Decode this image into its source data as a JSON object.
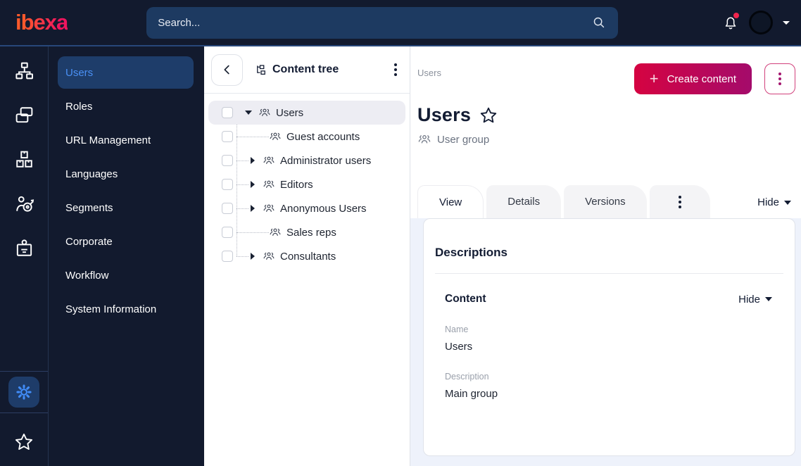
{
  "topbar": {
    "logo": "ibexa",
    "search_placeholder": "Search...",
    "has_notification": true
  },
  "rail": {
    "items": [
      {
        "icon": "sitemap-icon"
      },
      {
        "icon": "stacked-cards-icon"
      },
      {
        "icon": "packages-icon"
      },
      {
        "icon": "audience-target-icon"
      },
      {
        "icon": "id-badge-icon"
      }
    ],
    "settings_icon": "gear-icon",
    "favorites_icon": "star-icon"
  },
  "sidebar": {
    "items": [
      {
        "label": "Users",
        "selected": true
      },
      {
        "label": "Roles",
        "selected": false
      },
      {
        "label": "URL Management",
        "selected": false
      },
      {
        "label": "Languages",
        "selected": false
      },
      {
        "label": "Segments",
        "selected": false
      },
      {
        "label": "Corporate",
        "selected": false
      },
      {
        "label": "Workflow",
        "selected": false
      },
      {
        "label": "System Information",
        "selected": false
      }
    ]
  },
  "content_tree": {
    "title": "Content tree",
    "items": [
      {
        "label": "Users",
        "state": "expanded",
        "selected": true
      },
      {
        "label": "Guest accounts",
        "state": "leaf",
        "selected": false
      },
      {
        "label": "Administrator users",
        "state": "collapsed",
        "selected": false
      },
      {
        "label": "Editors",
        "state": "collapsed",
        "selected": false
      },
      {
        "label": "Anonymous Users",
        "state": "collapsed",
        "selected": false
      },
      {
        "label": "Sales reps",
        "state": "leaf",
        "selected": false
      },
      {
        "label": "Consultants",
        "state": "collapsed",
        "selected": false
      }
    ]
  },
  "main": {
    "breadcrumb": "Users",
    "create_button_label": "Create content",
    "page_title": "Users",
    "content_type_label": "User group",
    "tabs": [
      {
        "label": "View",
        "active": true
      },
      {
        "label": "Details",
        "active": false
      },
      {
        "label": "Versions",
        "active": false
      }
    ],
    "collapse_label": "Hide",
    "card": {
      "heading": "Descriptions",
      "section_title": "Content",
      "section_collapse_label": "Hide",
      "fields": [
        {
          "label": "Name",
          "value": "Users"
        },
        {
          "label": "Description",
          "value": "Main group"
        }
      ]
    }
  },
  "colors": {
    "topbar_bg": "#121a2e",
    "brand_gradient": [
      "#ff5a2b",
      "#ef155e"
    ],
    "primary_button_gradient": [
      "#d50341",
      "#a40b6b"
    ],
    "selected_nav_bg": "#1e3d6a",
    "selected_nav_text": "#4a90f5",
    "accent_blue": "#418cf8",
    "notification_red": "#f2254d",
    "content_bg": "#eef2fb"
  }
}
